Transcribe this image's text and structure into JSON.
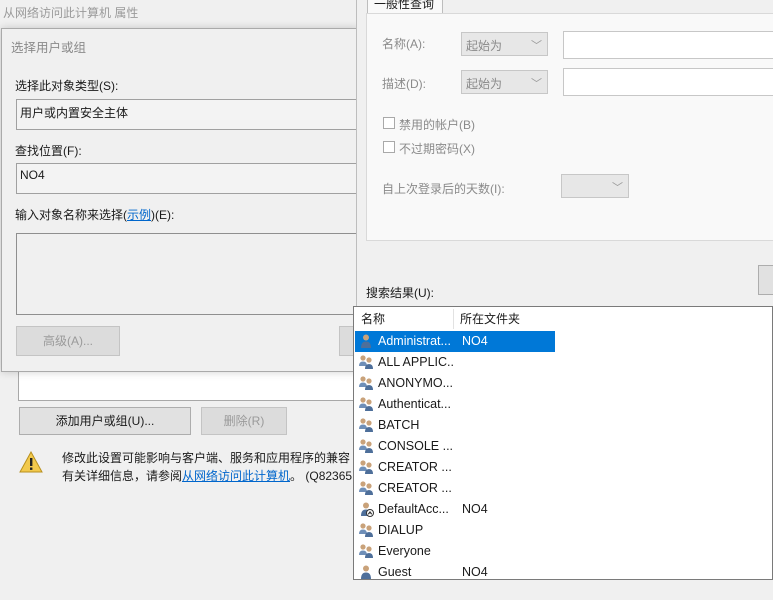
{
  "back_window": {
    "title": "从网络访问此计算机 属性",
    "add_button": "添加用户或组(U)...",
    "remove_button": "删除(R)",
    "warning_line1": "修改此设置可能影响与客户端、服务和应用程序的兼容",
    "warning_line2_pre": "有关详细信息，请参阅",
    "warning_link": "从网络访问此计算机",
    "warning_line2_post": "。 (Q82365"
  },
  "select_dialog": {
    "title": "选择用户或组",
    "object_type_label": "选择此对象类型(S):",
    "object_type_value": "用户或内置安全主体",
    "location_label": "查找位置(F):",
    "location_value": "NO4",
    "enter_names_label_pre": "输入对象名称来选择(",
    "enter_names_link": "示例",
    "enter_names_label_post": ")(E):",
    "advanced_button": "高级(A)..."
  },
  "advanced_panel": {
    "tab_label": "一般性查询",
    "name_label": "名称(A):",
    "name_mode": "起始为",
    "desc_label": "描述(D):",
    "desc_mode": "起始为",
    "disabled_accounts": "禁用的帐户(B)",
    "no_expire_password": "不过期密码(X)",
    "days_since_logon": "自上次登录后的天数(I):",
    "results_label": "搜索结果(U):"
  },
  "results": {
    "col_name": "名称",
    "col_folder": "所在文件夹",
    "rows": [
      {
        "name": "Administrat...",
        "folder": "NO4",
        "icon": "user-icon",
        "selected": true
      },
      {
        "name": "ALL APPLIC...",
        "folder": "",
        "icon": "group-icon"
      },
      {
        "name": "ANONYMO...",
        "folder": "",
        "icon": "group-icon"
      },
      {
        "name": "Authenticat...",
        "folder": "",
        "icon": "group-icon"
      },
      {
        "name": "BATCH",
        "folder": "",
        "icon": "group-icon"
      },
      {
        "name": "CONSOLE ...",
        "folder": "",
        "icon": "group-icon"
      },
      {
        "name": "CREATOR ...",
        "folder": "",
        "icon": "group-icon"
      },
      {
        "name": "CREATOR ...",
        "folder": "",
        "icon": "group-icon"
      },
      {
        "name": "DefaultAcc...",
        "folder": "NO4",
        "icon": "disabled-user-icon"
      },
      {
        "name": "DIALUP",
        "folder": "",
        "icon": "group-icon"
      },
      {
        "name": "Everyone",
        "folder": "",
        "icon": "group-icon"
      },
      {
        "name": "Guest",
        "folder": "NO4",
        "icon": "user-icon"
      }
    ]
  },
  "colors": {
    "selection": "#0078d7",
    "link": "#0066cc",
    "warning": "#f2c94c"
  }
}
